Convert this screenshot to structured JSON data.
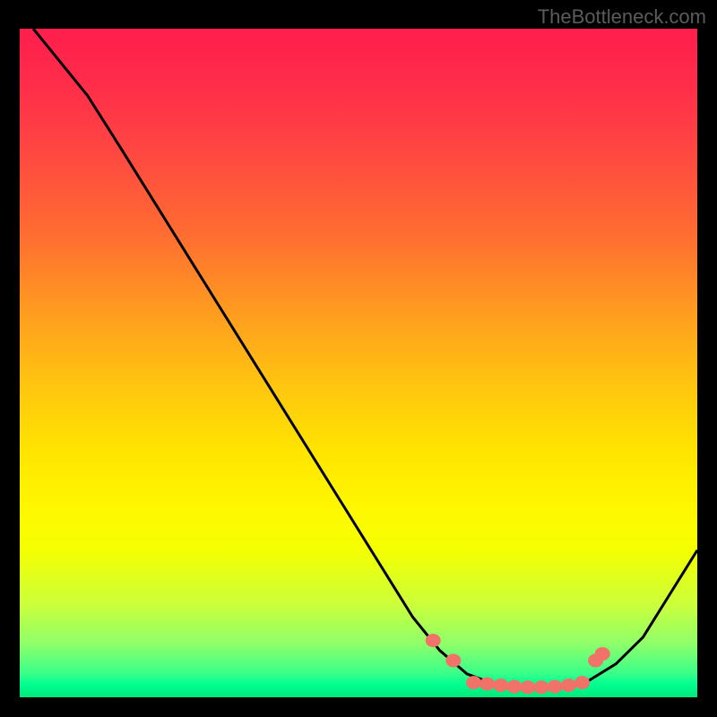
{
  "attribution": "TheBottleneck.com",
  "chart_data": {
    "type": "line",
    "title": "",
    "xlabel": "",
    "ylabel": "",
    "xlim": [
      0,
      100
    ],
    "ylim": [
      0,
      100
    ],
    "curve": {
      "name": "bottleneck-curve",
      "points": [
        {
          "x": 2,
          "y": 100
        },
        {
          "x": 10,
          "y": 90
        },
        {
          "x": 15,
          "y": 82
        },
        {
          "x": 58,
          "y": 12
        },
        {
          "x": 62,
          "y": 7
        },
        {
          "x": 66,
          "y": 3.5
        },
        {
          "x": 70,
          "y": 2
        },
        {
          "x": 75,
          "y": 1.5
        },
        {
          "x": 80,
          "y": 1.5
        },
        {
          "x": 84,
          "y": 2.5
        },
        {
          "x": 88,
          "y": 5
        },
        {
          "x": 92,
          "y": 9
        },
        {
          "x": 100,
          "y": 22
        }
      ]
    },
    "markers": [
      {
        "x": 61,
        "y": 8.5
      },
      {
        "x": 64,
        "y": 5.5
      },
      {
        "x": 67,
        "y": 2.2
      },
      {
        "x": 69,
        "y": 2.0
      },
      {
        "x": 71,
        "y": 1.8
      },
      {
        "x": 73,
        "y": 1.6
      },
      {
        "x": 75,
        "y": 1.5
      },
      {
        "x": 77,
        "y": 1.5
      },
      {
        "x": 79,
        "y": 1.6
      },
      {
        "x": 81,
        "y": 1.8
      },
      {
        "x": 83,
        "y": 2.2
      },
      {
        "x": 85,
        "y": 5.5
      },
      {
        "x": 86,
        "y": 6.5
      }
    ],
    "background": {
      "type": "vertical-gradient",
      "stops": [
        {
          "pos": 0,
          "color": "#ff1e4c"
        },
        {
          "pos": 50,
          "color": "#ffc410"
        },
        {
          "pos": 75,
          "color": "#fff800"
        },
        {
          "pos": 100,
          "color": "#00e87a"
        }
      ]
    }
  }
}
